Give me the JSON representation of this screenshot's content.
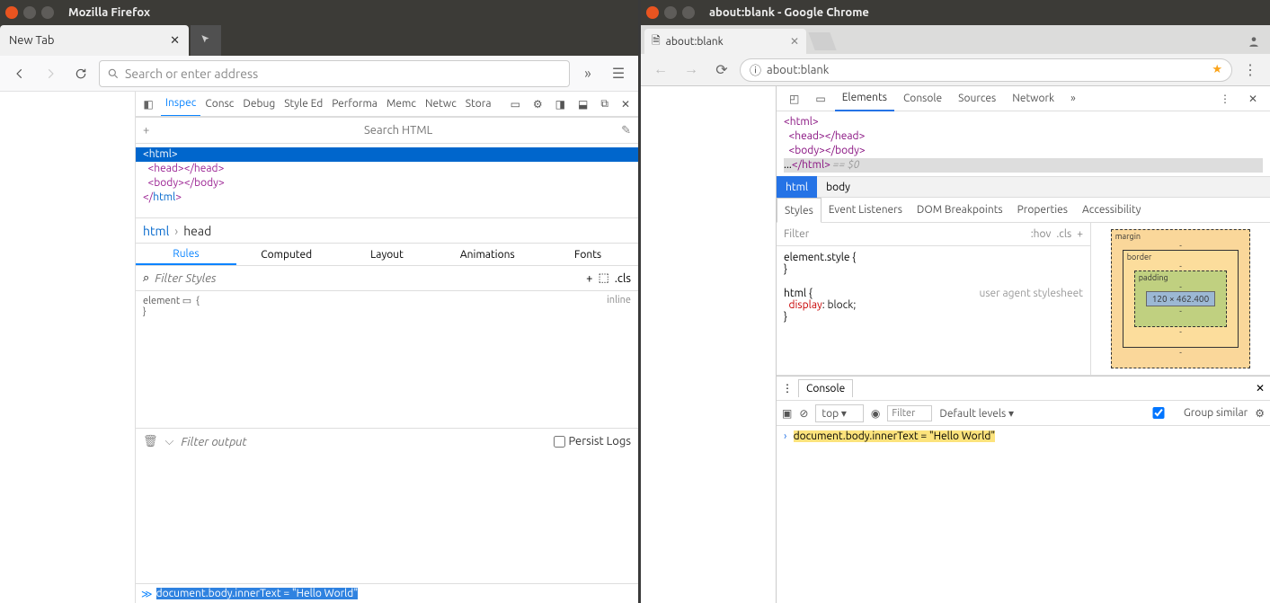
{
  "firefox": {
    "title": "Mozilla Firefox",
    "tab": "New Tab",
    "addressPlaceholder": "Search or enter address",
    "devtools": {
      "tabs": [
        "Inspec",
        "Consc",
        "Debug",
        "Style Ed",
        "Performa",
        "Memc",
        "Netwc",
        "Stora"
      ],
      "activeTab": "Inspec",
      "searchPlaceholder": "Search HTML",
      "tree": {
        "line1": "<html>",
        "line2_open": "<head>",
        "line2_close": "</head>",
        "line3_open": "<body>",
        "line3_close": "</body>",
        "line4": "</html>"
      },
      "breadcrumbs": [
        "html",
        "head"
      ],
      "styleTabs": [
        "Rules",
        "Computed",
        "Layout",
        "Animations",
        "Fonts"
      ],
      "styleActive": "Rules",
      "filterStyles": "Filter Styles",
      "clsLabel": ".cls",
      "rule": "element",
      "ruleOpen": "{",
      "ruleClose": "}",
      "inlineLabel": "inline",
      "filterOutput": "Filter output",
      "persistLogs": "Persist Logs",
      "consoleCmd": "document.body.innerText = \"Hello World\""
    }
  },
  "chrome": {
    "title": "about:blank - Google Chrome",
    "tab": "about:blank",
    "url": "about:blank",
    "devtools": {
      "tabs": [
        "Elements",
        "Console",
        "Sources",
        "Network"
      ],
      "activeTab": "Elements",
      "tree": {
        "open_html": "<html>",
        "head": "<head></head>",
        "body": "<body></body>",
        "close_html": "</html>",
        "dim": "== $0",
        "ellipsis": "..."
      },
      "crumbs": [
        "html",
        "body"
      ],
      "sideTabs": [
        "Styles",
        "Event Listeners",
        "DOM Breakpoints",
        "Properties",
        "Accessibility"
      ],
      "sideActive": "Styles",
      "filter": "Filter",
      "hov": ":hov",
      "cls": ".cls",
      "emptyRule": "element.style {",
      "emptyRuleClose": "}",
      "htmlRule": "html {",
      "uas": "user agent stylesheet",
      "displayProp": "display",
      "displayVal": ": block;",
      "htmlRuleClose": "}",
      "box": {
        "margin": "margin",
        "border": "border",
        "padding": "padding",
        "dash": "-",
        "content": "120 × 462.400"
      },
      "consoleLabel": "Console",
      "topLabel": "top",
      "filterConsole": "Filter",
      "defaultLevels": "Default levels",
      "groupSimilar": "Group similar",
      "consoleCmd": "document.body.innerText = \"Hello World\""
    }
  }
}
